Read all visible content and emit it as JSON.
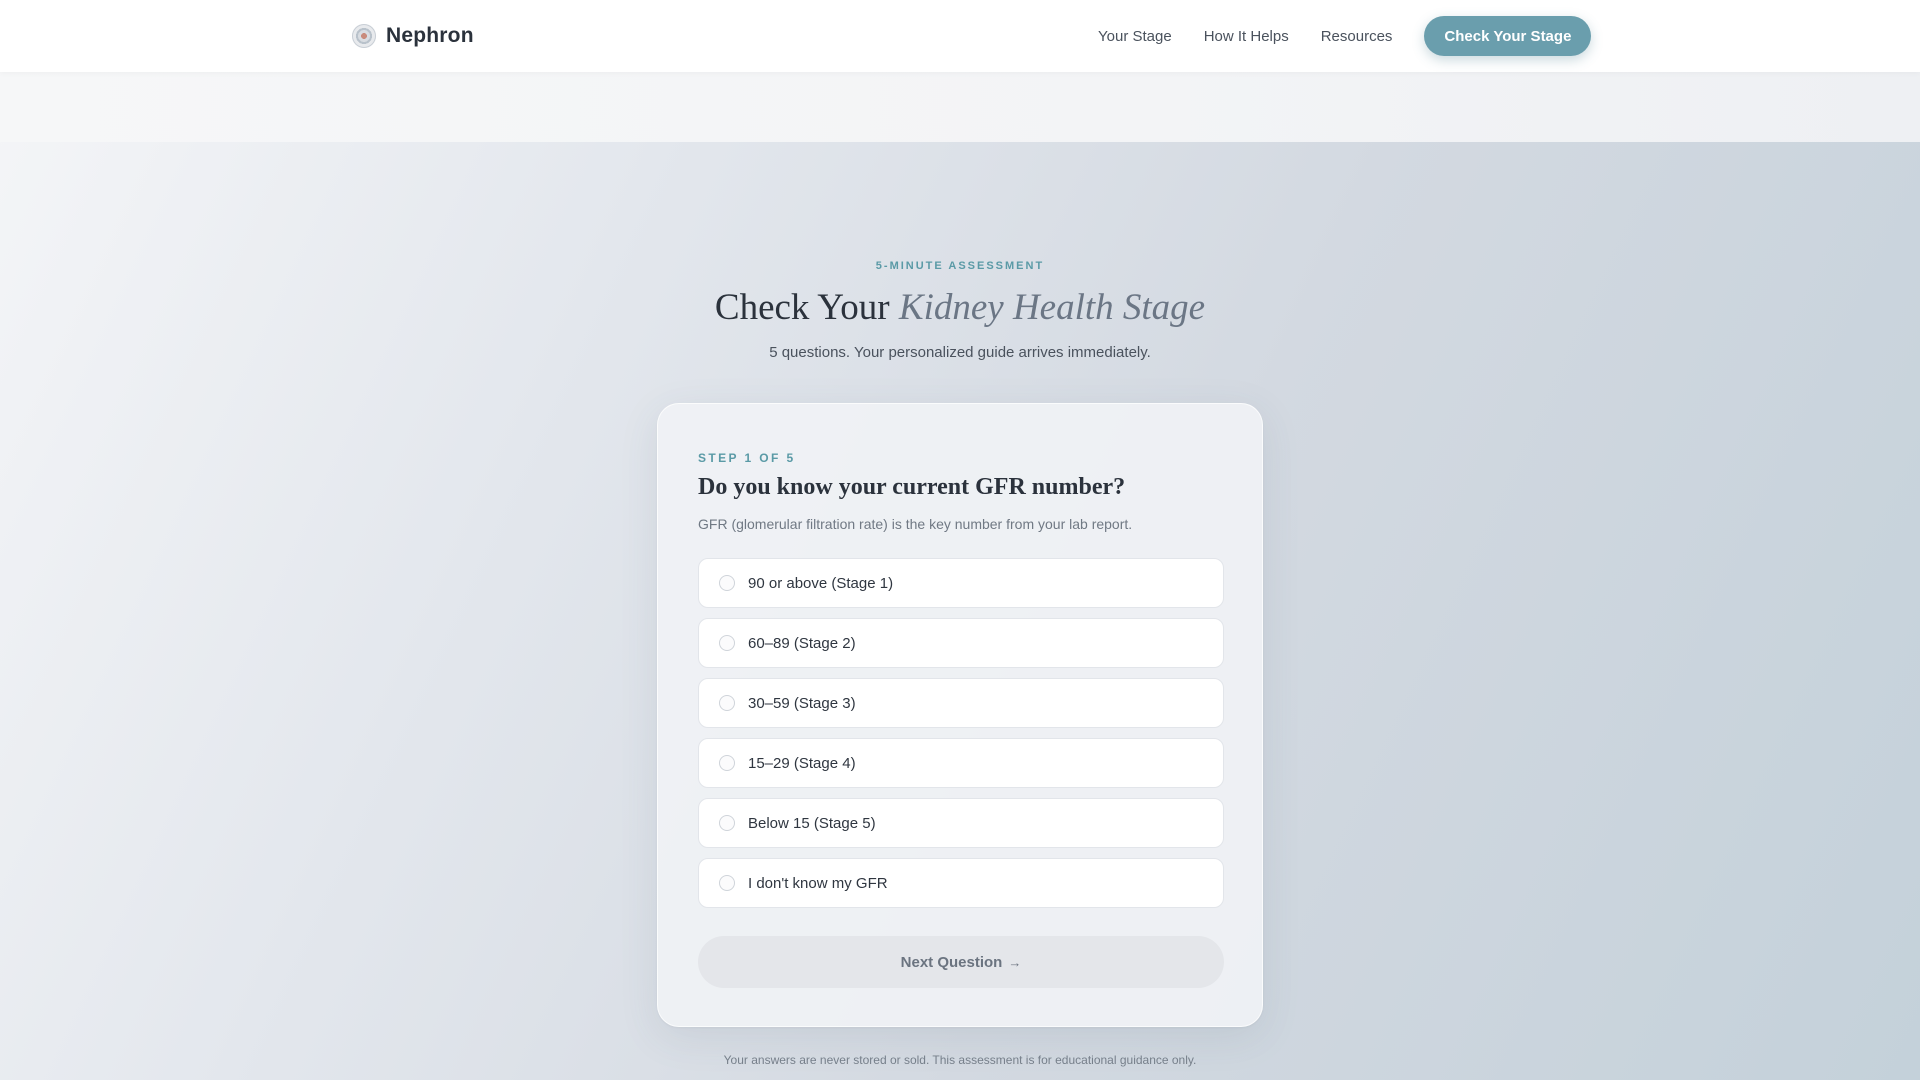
{
  "header": {
    "brand": "Nephron",
    "nav": [
      "Your Stage",
      "How It Helps",
      "Resources"
    ],
    "cta": "Check Your Stage"
  },
  "hero": {
    "eyebrow": "5-MINUTE ASSESSMENT",
    "title_main": "Check Your",
    "title_accent": "Kidney Health Stage",
    "subtitle": "5 questions. Your personalized guide arrives immediately."
  },
  "quiz": {
    "step": "STEP 1 OF 5",
    "question": "Do you know your current GFR number?",
    "help": "GFR (glomerular filtration rate) is the key number from your lab report.",
    "options": [
      "90 or above (Stage 1)",
      "60–89 (Stage 2)",
      "30–59 (Stage 3)",
      "15–29 (Stage 4)",
      "Below 15 (Stage 5)",
      "I don't know my GFR"
    ],
    "next_label": "Next Question",
    "next_arrow": "→"
  },
  "footnote": "Your answers are never stored or sold. This assessment is for educational guidance only.",
  "colors": {
    "accent": "#6a9ead",
    "eyebrow": "#5a9aa6",
    "text": "#2b323c"
  },
  "icons": {
    "logo": "kidney-logo-icon",
    "radio": "radio-unchecked-icon",
    "arrow": "arrow-right-icon"
  }
}
